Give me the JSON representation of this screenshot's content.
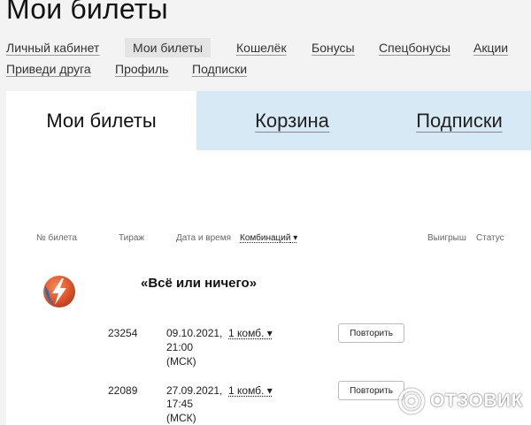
{
  "page": {
    "title": "Мои билеты"
  },
  "nav": {
    "items": [
      {
        "label": "Личный кабинет"
      },
      {
        "label": "Мои билеты"
      },
      {
        "label": "Кошелёк"
      },
      {
        "label": "Бонусы"
      },
      {
        "label": "Спецбонусы"
      },
      {
        "label": "Акции"
      },
      {
        "label": "Приведи друга"
      },
      {
        "label": "Профиль"
      },
      {
        "label": "Подписки"
      }
    ]
  },
  "tabs": [
    {
      "label": "Мои билеты"
    },
    {
      "label": "Корзина"
    },
    {
      "label": "Подписки"
    }
  ],
  "table": {
    "headers": {
      "ticket": "№ билета",
      "draw": "Тираж",
      "datetime": "Дата и время",
      "combination": "Комбинаций",
      "win": "Выигрыш",
      "status": "Статус"
    },
    "game_title": "«Всё или ничего»",
    "rows": [
      {
        "draw": "23254",
        "date": "09.10.2021,",
        "time": "21:00",
        "tz": "(МСК)",
        "combo": "1 комб.",
        "button": "Повторить"
      },
      {
        "draw": "22089",
        "date": "27.09.2021,",
        "time": "17:45",
        "tz": "(МСК)",
        "combo": "1 комб.",
        "button": "Повторить"
      }
    ]
  },
  "watermark": {
    "text": "ОТЗОВИК"
  },
  "colors": {
    "tab_inactive_bg": "#d7e9f5",
    "logo_orange": "#e2572c",
    "logo_blue": "#1f6fb2"
  }
}
